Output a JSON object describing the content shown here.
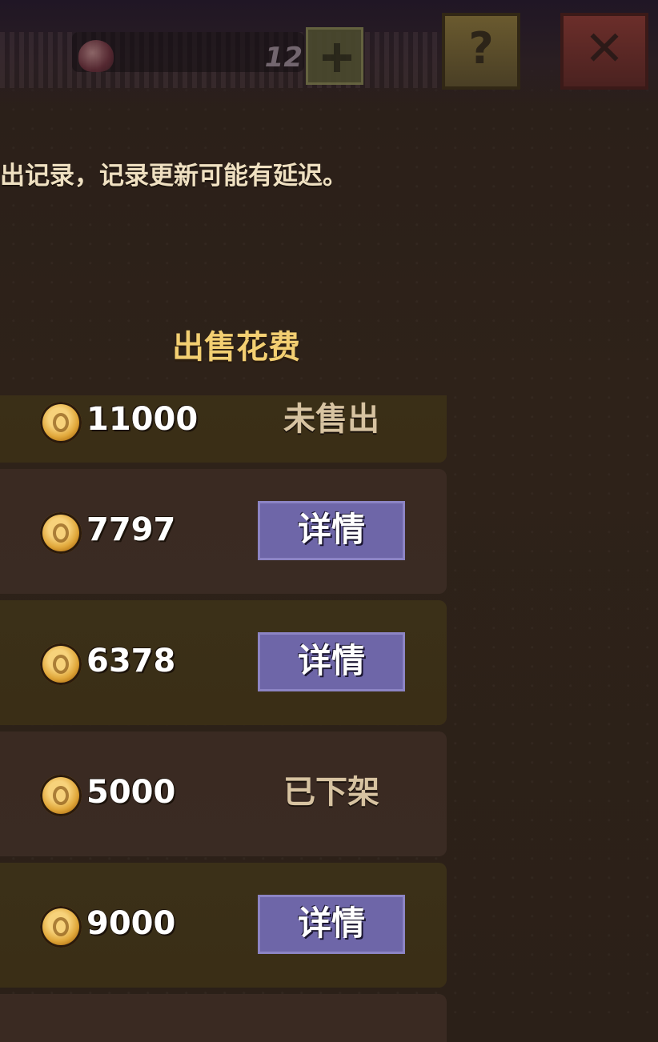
{
  "topbar": {
    "resource_value": "12",
    "help_label": "?",
    "close_label": "✕"
  },
  "notice": "出记录，记录更新可能有延迟。",
  "list": {
    "cost_header": "出售花费",
    "rows": [
      {
        "price": "11000",
        "status": "未售出",
        "action": ""
      },
      {
        "price": "7797",
        "status": "",
        "action": "详情"
      },
      {
        "price": "6378",
        "status": "",
        "action": "详情"
      },
      {
        "price": "5000",
        "status": "已下架",
        "action": ""
      },
      {
        "price": "9000",
        "status": "",
        "action": "详情"
      }
    ]
  },
  "colors": {
    "header_gold": "#f3cf72",
    "button_purple": "#6e66a8",
    "row_gold": "#3b3018",
    "row_brown": "#3a2a22"
  },
  "icons": [
    "heart-icon",
    "plus-icon",
    "help-icon",
    "close-icon",
    "coin-icon"
  ]
}
